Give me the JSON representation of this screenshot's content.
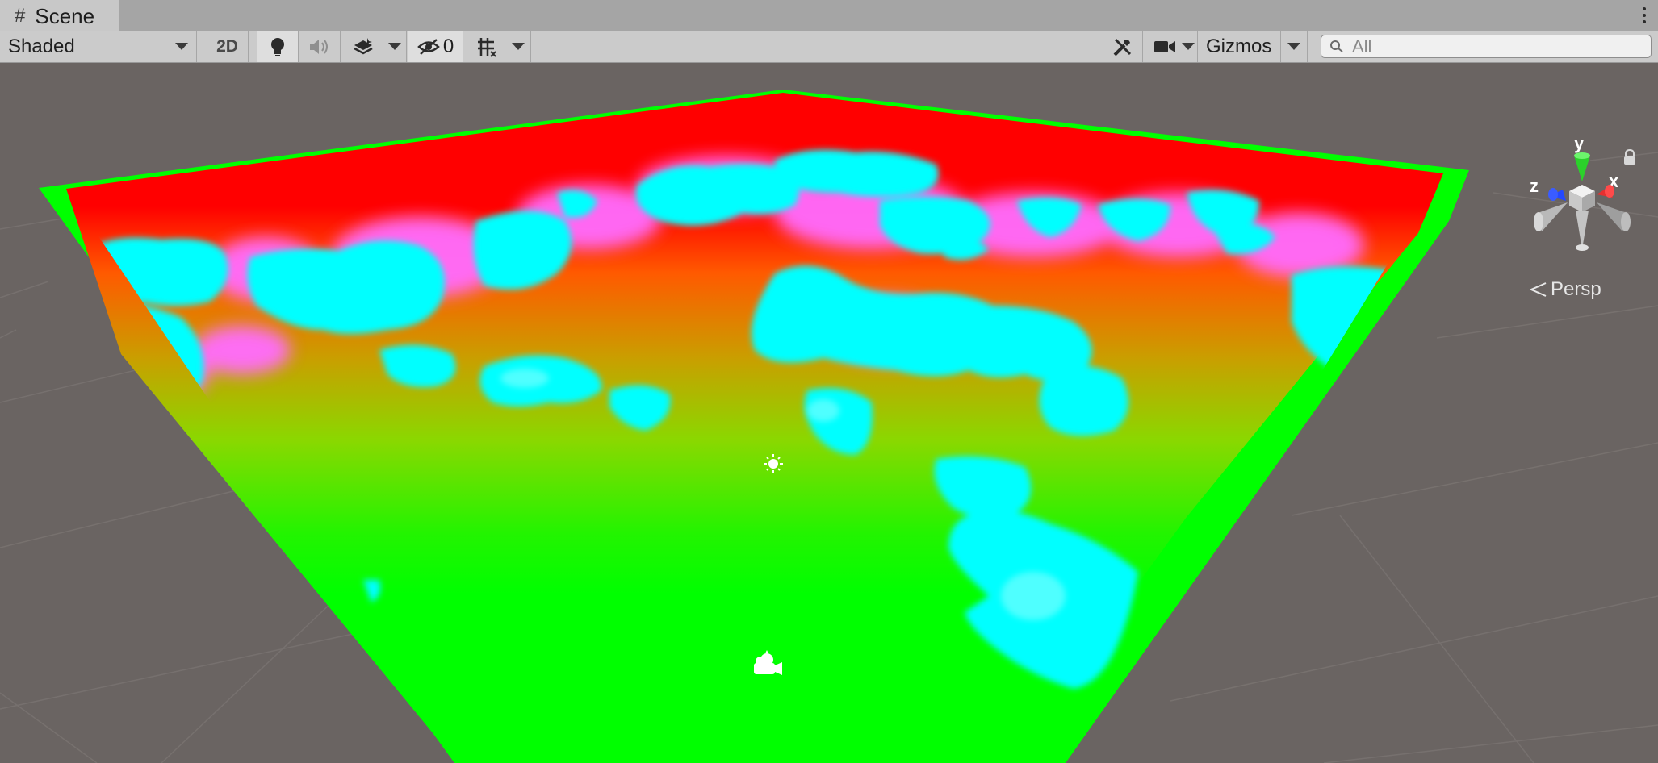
{
  "tab": {
    "icon": "hash-icon",
    "label": "Scene"
  },
  "toolbar": {
    "draw_mode": "Shaded",
    "mode_2d": "2D",
    "hidden_count": "0",
    "gizmos": "Gizmos",
    "search_placeholder": "All"
  },
  "gizmo": {
    "y": "y",
    "x": "x",
    "z": "z"
  },
  "projection": "Persp",
  "colors": {
    "plane_green": "#00ff00",
    "water_cyan": "#00ffff",
    "hot_red": "#ff0000",
    "magenta": "#ff66ff",
    "background": "#6a6462"
  }
}
